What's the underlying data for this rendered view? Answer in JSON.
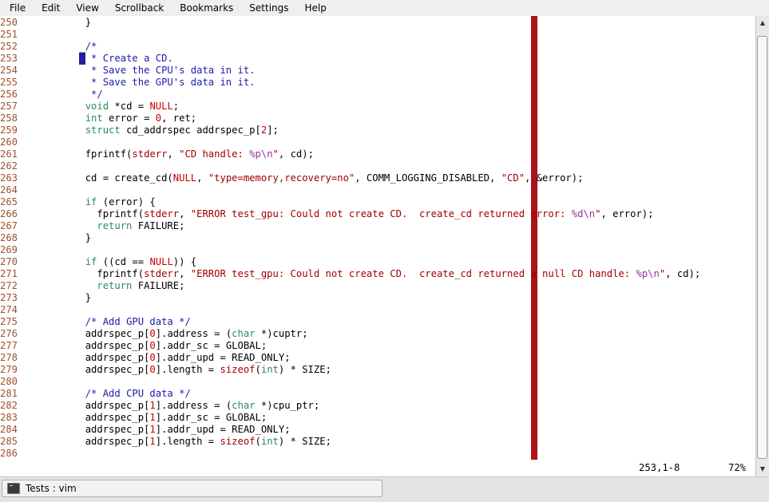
{
  "menu": [
    "File",
    "Edit",
    "View",
    "Scrollback",
    "Bookmarks",
    "Settings",
    "Help"
  ],
  "editor": {
    "lines": [
      [
        {
          "t": "250",
          "c": "ln"
        },
        {
          "t": "        }"
        }
      ],
      [
        {
          "t": "251",
          "c": "ln"
        }
      ],
      [
        {
          "t": "252",
          "c": "ln"
        },
        {
          "t": "        "
        },
        {
          "t": "/*",
          "c": "cm"
        }
      ],
      [
        {
          "t": "253",
          "c": "ln"
        },
        {
          "t": "       "
        },
        {
          "t": "█",
          "c": "cursor"
        },
        {
          "t": " * Create a CD.",
          "c": "cm"
        }
      ],
      [
        {
          "t": "254",
          "c": "ln"
        },
        {
          "t": "        "
        },
        {
          "t": " * Save the CPU's data in it.",
          "c": "cm"
        }
      ],
      [
        {
          "t": "255",
          "c": "ln"
        },
        {
          "t": "        "
        },
        {
          "t": " * Save the GPU's data in it.",
          "c": "cm"
        }
      ],
      [
        {
          "t": "256",
          "c": "ln"
        },
        {
          "t": "        "
        },
        {
          "t": " */",
          "c": "cm"
        }
      ],
      [
        {
          "t": "257",
          "c": "ln"
        },
        {
          "t": "        "
        },
        {
          "t": "void",
          "c": "ty"
        },
        {
          "t": " *cd = "
        },
        {
          "t": "NULL",
          "c": "ct"
        },
        {
          "t": ";"
        }
      ],
      [
        {
          "t": "258",
          "c": "ln"
        },
        {
          "t": "        "
        },
        {
          "t": "int",
          "c": "ty"
        },
        {
          "t": " error = "
        },
        {
          "t": "0",
          "c": "ct"
        },
        {
          "t": ", ret;"
        }
      ],
      [
        {
          "t": "259",
          "c": "ln"
        },
        {
          "t": "        "
        },
        {
          "t": "struct",
          "c": "ty"
        },
        {
          "t": " cd_addrspec addrspec_p["
        },
        {
          "t": "2",
          "c": "ct"
        },
        {
          "t": "];"
        }
      ],
      [
        {
          "t": "260",
          "c": "ln"
        }
      ],
      [
        {
          "t": "261",
          "c": "ln"
        },
        {
          "t": "        fprintf("
        },
        {
          "t": "stderr",
          "c": "st"
        },
        {
          "t": ", "
        },
        {
          "t": "\"CD handle: ",
          "c": "st"
        },
        {
          "t": "%p\\n",
          "c": "sp"
        },
        {
          "t": "\"",
          "c": "st"
        },
        {
          "t": ", cd);"
        }
      ],
      [
        {
          "t": "262",
          "c": "ln"
        }
      ],
      [
        {
          "t": "263",
          "c": "ln"
        },
        {
          "t": "        cd = create_cd("
        },
        {
          "t": "NULL",
          "c": "ct"
        },
        {
          "t": ", "
        },
        {
          "t": "\"type=memory,recovery=no\"",
          "c": "st"
        },
        {
          "t": ", COMM_LOGGING_DISABLED, "
        },
        {
          "t": "\"CD\"",
          "c": "st"
        },
        {
          "t": ", &error);"
        }
      ],
      [
        {
          "t": "264",
          "c": "ln"
        }
      ],
      [
        {
          "t": "265",
          "c": "ln"
        },
        {
          "t": "        "
        },
        {
          "t": "if",
          "c": "ty"
        },
        {
          "t": " (error) {"
        }
      ],
      [
        {
          "t": "266",
          "c": "ln"
        },
        {
          "t": "          fprintf("
        },
        {
          "t": "stderr",
          "c": "st"
        },
        {
          "t": ", "
        },
        {
          "t": "\"ERROR test_gpu: Could not create CD.  create_cd returned error: ",
          "c": "st"
        },
        {
          "t": "%d\\n",
          "c": "sp"
        },
        {
          "t": "\"",
          "c": "st"
        },
        {
          "t": ", error);"
        }
      ],
      [
        {
          "t": "267",
          "c": "ln"
        },
        {
          "t": "          "
        },
        {
          "t": "return",
          "c": "ty"
        },
        {
          "t": " FAILURE;"
        }
      ],
      [
        {
          "t": "268",
          "c": "ln"
        },
        {
          "t": "        }"
        }
      ],
      [
        {
          "t": "269",
          "c": "ln"
        }
      ],
      [
        {
          "t": "270",
          "c": "ln"
        },
        {
          "t": "        "
        },
        {
          "t": "if",
          "c": "ty"
        },
        {
          "t": " ((cd == "
        },
        {
          "t": "NULL",
          "c": "ct"
        },
        {
          "t": ")) {"
        }
      ],
      [
        {
          "t": "271",
          "c": "ln"
        },
        {
          "t": "          fprintf("
        },
        {
          "t": "stderr",
          "c": "st"
        },
        {
          "t": ", "
        },
        {
          "t": "\"ERROR test_gpu: Could not create CD.  create_cd returned a null CD handle: ",
          "c": "st"
        },
        {
          "t": "%p\\n",
          "c": "sp"
        },
        {
          "t": "\"",
          "c": "st"
        },
        {
          "t": ", cd);"
        }
      ],
      [
        {
          "t": "272",
          "c": "ln"
        },
        {
          "t": "          "
        },
        {
          "t": "return",
          "c": "ty"
        },
        {
          "t": " FAILURE;"
        }
      ],
      [
        {
          "t": "273",
          "c": "ln"
        },
        {
          "t": "        }"
        }
      ],
      [
        {
          "t": "274",
          "c": "ln"
        }
      ],
      [
        {
          "t": "275",
          "c": "ln"
        },
        {
          "t": "        "
        },
        {
          "t": "/* Add GPU data */",
          "c": "cm"
        }
      ],
      [
        {
          "t": "276",
          "c": "ln"
        },
        {
          "t": "        addrspec_p["
        },
        {
          "t": "0",
          "c": "ct"
        },
        {
          "t": "].address = ("
        },
        {
          "t": "char",
          "c": "ty"
        },
        {
          "t": " *)cuptr;"
        }
      ],
      [
        {
          "t": "277",
          "c": "ln"
        },
        {
          "t": "        addrspec_p["
        },
        {
          "t": "0",
          "c": "ct"
        },
        {
          "t": "].addr_sc = GLOBAL;"
        }
      ],
      [
        {
          "t": "278",
          "c": "ln"
        },
        {
          "t": "        addrspec_p["
        },
        {
          "t": "0",
          "c": "ct"
        },
        {
          "t": "].addr_upd = READ_ONLY;"
        }
      ],
      [
        {
          "t": "279",
          "c": "ln"
        },
        {
          "t": "        addrspec_p["
        },
        {
          "t": "0",
          "c": "ct"
        },
        {
          "t": "].length = "
        },
        {
          "t": "sizeof",
          "c": "st"
        },
        {
          "t": "("
        },
        {
          "t": "int",
          "c": "ty"
        },
        {
          "t": ") * SIZE;"
        }
      ],
      [
        {
          "t": "280",
          "c": "ln"
        }
      ],
      [
        {
          "t": "281",
          "c": "ln"
        },
        {
          "t": "        "
        },
        {
          "t": "/* Add CPU data */",
          "c": "cm"
        }
      ],
      [
        {
          "t": "282",
          "c": "ln"
        },
        {
          "t": "        addrspec_p["
        },
        {
          "t": "1",
          "c": "ct"
        },
        {
          "t": "].address = ("
        },
        {
          "t": "char",
          "c": "ty"
        },
        {
          "t": " *)cpu_ptr;"
        }
      ],
      [
        {
          "t": "283",
          "c": "ln"
        },
        {
          "t": "        addrspec_p["
        },
        {
          "t": "1",
          "c": "ct"
        },
        {
          "t": "].addr_sc = GLOBAL;"
        }
      ],
      [
        {
          "t": "284",
          "c": "ln"
        },
        {
          "t": "        addrspec_p["
        },
        {
          "t": "1",
          "c": "ct"
        },
        {
          "t": "].addr_upd = READ_ONLY;"
        }
      ],
      [
        {
          "t": "285",
          "c": "ln"
        },
        {
          "t": "        addrspec_p["
        },
        {
          "t": "1",
          "c": "ct"
        },
        {
          "t": "].length = "
        },
        {
          "t": "sizeof",
          "c": "st"
        },
        {
          "t": "("
        },
        {
          "t": "int",
          "c": "ty"
        },
        {
          "t": ") * SIZE;"
        }
      ],
      [
        {
          "t": "286",
          "c": "ln"
        }
      ]
    ],
    "ruler_position": "253,1-8",
    "ruler_percent": "72%",
    "colorcolumn_color": "#a8141a"
  },
  "scrollbar": {
    "up_icon": "▲",
    "down_icon": "▼",
    "position_percent": 72
  },
  "taskbar": {
    "task_label": "Tests : vim"
  }
}
